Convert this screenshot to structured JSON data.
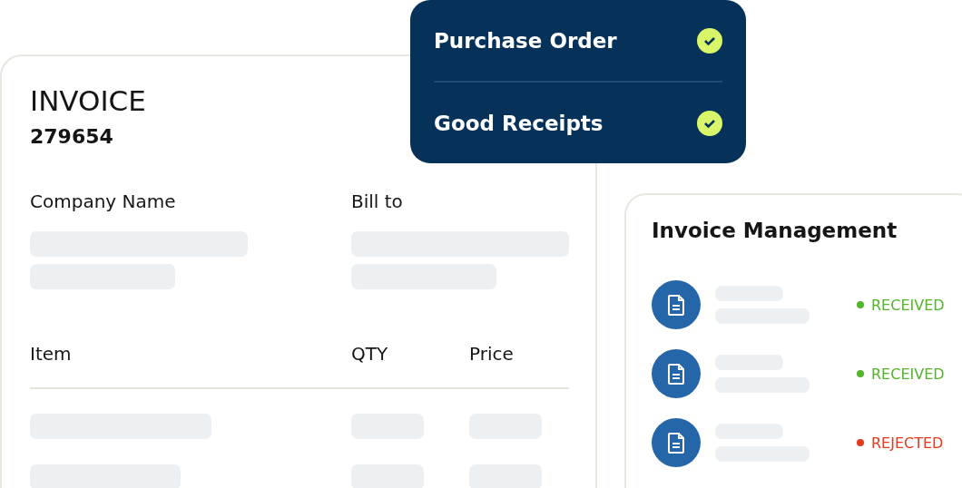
{
  "invoice": {
    "title": "INVOICE",
    "number": "279654",
    "fields": [
      {
        "label": "Company Name"
      },
      {
        "label": "Bill to"
      }
    ],
    "table": {
      "columns": [
        "Item",
        "QTY",
        "Price"
      ]
    }
  },
  "checklist": {
    "items": [
      {
        "label": "Purchase Order",
        "checked": true
      },
      {
        "label": "Good Receipts",
        "checked": true
      }
    ]
  },
  "invoice_management": {
    "title": "Invoice Management",
    "rows": [
      {
        "status": "RECEIVED",
        "color": "#52b52a"
      },
      {
        "status": "RECEIVED",
        "color": "#52b52a"
      },
      {
        "status": "REJECTED",
        "color": "#e53a1e"
      }
    ]
  }
}
